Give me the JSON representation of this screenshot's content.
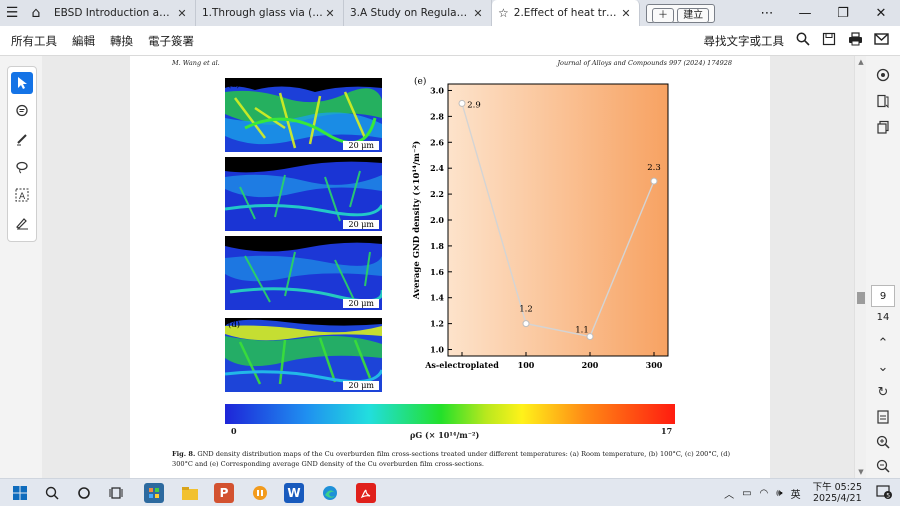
{
  "tabs": [
    {
      "label": "EBSD Introduction and Basic...",
      "active": false
    },
    {
      "label": "1.Through glass via (TGV) co...",
      "active": false
    },
    {
      "label": "3.A Study on Regulating the ...",
      "active": false
    },
    {
      "label": "2.Effect of heat treat...",
      "active": true
    }
  ],
  "new_tab_label": "建立",
  "menu": [
    "所有工具",
    "編輯",
    "轉換",
    "電子簽署"
  ],
  "find_label": "尋找文字或工具",
  "document": {
    "header_left": "M. Wang et al.",
    "header_right": "Journal of Alloys and Compounds 997 (2024) 174928",
    "panels": [
      {
        "label": "(a)",
        "scale": "20 μm"
      },
      {
        "label": "(b)",
        "scale": "20 μm"
      },
      {
        "label": "(c)",
        "scale": "20 μm"
      },
      {
        "label": "(d)",
        "scale": "20 μm"
      }
    ],
    "colorbar": {
      "min": "0",
      "max": "17",
      "label": "ρG (× 10¹⁴/m⁻²)"
    },
    "caption_title": "Fig. 8.",
    "caption_text": "GND density distribution maps of the Cu overburden film cross-sections treated under different temperatures: (a) Room temperature, (b) 100°C, (c) 200°C, (d) 300°C and (e) Corresponding average GND density of the Cu overburden film cross-sections."
  },
  "chart_data": {
    "type": "line",
    "panel_label": "(e)",
    "categories": [
      "As-electroplated",
      "100",
      "200",
      "300"
    ],
    "values": [
      2.9,
      1.2,
      1.1,
      2.3
    ],
    "data_labels": [
      "2.9",
      "1.2",
      "1.1",
      "2.3"
    ],
    "ylabel": "Average GND density (×10¹⁴/m⁻²)",
    "ylim": [
      0.95,
      3.05
    ],
    "yticks": [
      "1.0",
      "1.2",
      "1.4",
      "1.6",
      "1.8",
      "2.0",
      "2.2",
      "2.4",
      "2.6",
      "2.8",
      "3.0"
    ],
    "background_gradient": [
      "#fde3cb",
      "#f7a262"
    ],
    "line_color": "#d4d4d4",
    "grid": false
  },
  "page_number": "9",
  "page_count": "14",
  "clock": {
    "time": "下午 05:25",
    "date": "2025/4/21"
  },
  "ime": "英",
  "notifications": "5"
}
